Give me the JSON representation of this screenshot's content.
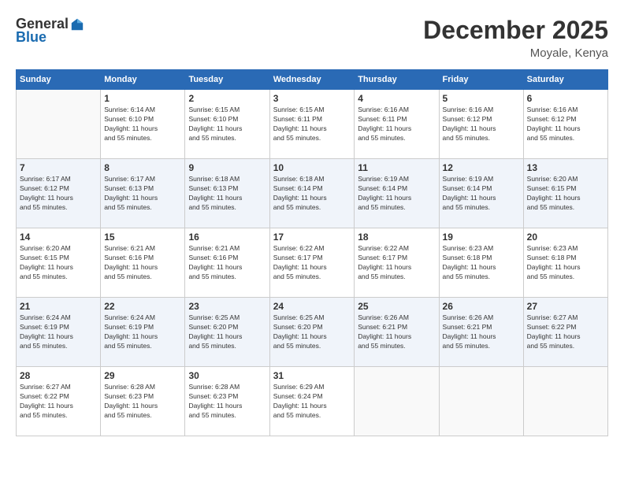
{
  "logo": {
    "general": "General",
    "blue": "Blue"
  },
  "header": {
    "month": "December 2025",
    "location": "Moyale, Kenya"
  },
  "days_of_week": [
    "Sunday",
    "Monday",
    "Tuesday",
    "Wednesday",
    "Thursday",
    "Friday",
    "Saturday"
  ],
  "weeks": [
    [
      {
        "day": "",
        "info": ""
      },
      {
        "day": "1",
        "info": "Sunrise: 6:14 AM\nSunset: 6:10 PM\nDaylight: 11 hours\nand 55 minutes."
      },
      {
        "day": "2",
        "info": "Sunrise: 6:15 AM\nSunset: 6:10 PM\nDaylight: 11 hours\nand 55 minutes."
      },
      {
        "day": "3",
        "info": "Sunrise: 6:15 AM\nSunset: 6:11 PM\nDaylight: 11 hours\nand 55 minutes."
      },
      {
        "day": "4",
        "info": "Sunrise: 6:16 AM\nSunset: 6:11 PM\nDaylight: 11 hours\nand 55 minutes."
      },
      {
        "day": "5",
        "info": "Sunrise: 6:16 AM\nSunset: 6:12 PM\nDaylight: 11 hours\nand 55 minutes."
      },
      {
        "day": "6",
        "info": "Sunrise: 6:16 AM\nSunset: 6:12 PM\nDaylight: 11 hours\nand 55 minutes."
      }
    ],
    [
      {
        "day": "7",
        "info": "Sunrise: 6:17 AM\nSunset: 6:12 PM\nDaylight: 11 hours\nand 55 minutes."
      },
      {
        "day": "8",
        "info": "Sunrise: 6:17 AM\nSunset: 6:13 PM\nDaylight: 11 hours\nand 55 minutes."
      },
      {
        "day": "9",
        "info": "Sunrise: 6:18 AM\nSunset: 6:13 PM\nDaylight: 11 hours\nand 55 minutes."
      },
      {
        "day": "10",
        "info": "Sunrise: 6:18 AM\nSunset: 6:14 PM\nDaylight: 11 hours\nand 55 minutes."
      },
      {
        "day": "11",
        "info": "Sunrise: 6:19 AM\nSunset: 6:14 PM\nDaylight: 11 hours\nand 55 minutes."
      },
      {
        "day": "12",
        "info": "Sunrise: 6:19 AM\nSunset: 6:14 PM\nDaylight: 11 hours\nand 55 minutes."
      },
      {
        "day": "13",
        "info": "Sunrise: 6:20 AM\nSunset: 6:15 PM\nDaylight: 11 hours\nand 55 minutes."
      }
    ],
    [
      {
        "day": "14",
        "info": "Sunrise: 6:20 AM\nSunset: 6:15 PM\nDaylight: 11 hours\nand 55 minutes."
      },
      {
        "day": "15",
        "info": "Sunrise: 6:21 AM\nSunset: 6:16 PM\nDaylight: 11 hours\nand 55 minutes."
      },
      {
        "day": "16",
        "info": "Sunrise: 6:21 AM\nSunset: 6:16 PM\nDaylight: 11 hours\nand 55 minutes."
      },
      {
        "day": "17",
        "info": "Sunrise: 6:22 AM\nSunset: 6:17 PM\nDaylight: 11 hours\nand 55 minutes."
      },
      {
        "day": "18",
        "info": "Sunrise: 6:22 AM\nSunset: 6:17 PM\nDaylight: 11 hours\nand 55 minutes."
      },
      {
        "day": "19",
        "info": "Sunrise: 6:23 AM\nSunset: 6:18 PM\nDaylight: 11 hours\nand 55 minutes."
      },
      {
        "day": "20",
        "info": "Sunrise: 6:23 AM\nSunset: 6:18 PM\nDaylight: 11 hours\nand 55 minutes."
      }
    ],
    [
      {
        "day": "21",
        "info": "Sunrise: 6:24 AM\nSunset: 6:19 PM\nDaylight: 11 hours\nand 55 minutes."
      },
      {
        "day": "22",
        "info": "Sunrise: 6:24 AM\nSunset: 6:19 PM\nDaylight: 11 hours\nand 55 minutes."
      },
      {
        "day": "23",
        "info": "Sunrise: 6:25 AM\nSunset: 6:20 PM\nDaylight: 11 hours\nand 55 minutes."
      },
      {
        "day": "24",
        "info": "Sunrise: 6:25 AM\nSunset: 6:20 PM\nDaylight: 11 hours\nand 55 minutes."
      },
      {
        "day": "25",
        "info": "Sunrise: 6:26 AM\nSunset: 6:21 PM\nDaylight: 11 hours\nand 55 minutes."
      },
      {
        "day": "26",
        "info": "Sunrise: 6:26 AM\nSunset: 6:21 PM\nDaylight: 11 hours\nand 55 minutes."
      },
      {
        "day": "27",
        "info": "Sunrise: 6:27 AM\nSunset: 6:22 PM\nDaylight: 11 hours\nand 55 minutes."
      }
    ],
    [
      {
        "day": "28",
        "info": "Sunrise: 6:27 AM\nSunset: 6:22 PM\nDaylight: 11 hours\nand 55 minutes."
      },
      {
        "day": "29",
        "info": "Sunrise: 6:28 AM\nSunset: 6:23 PM\nDaylight: 11 hours\nand 55 minutes."
      },
      {
        "day": "30",
        "info": "Sunrise: 6:28 AM\nSunset: 6:23 PM\nDaylight: 11 hours\nand 55 minutes."
      },
      {
        "day": "31",
        "info": "Sunrise: 6:29 AM\nSunset: 6:24 PM\nDaylight: 11 hours\nand 55 minutes."
      },
      {
        "day": "",
        "info": ""
      },
      {
        "day": "",
        "info": ""
      },
      {
        "day": "",
        "info": ""
      }
    ]
  ]
}
